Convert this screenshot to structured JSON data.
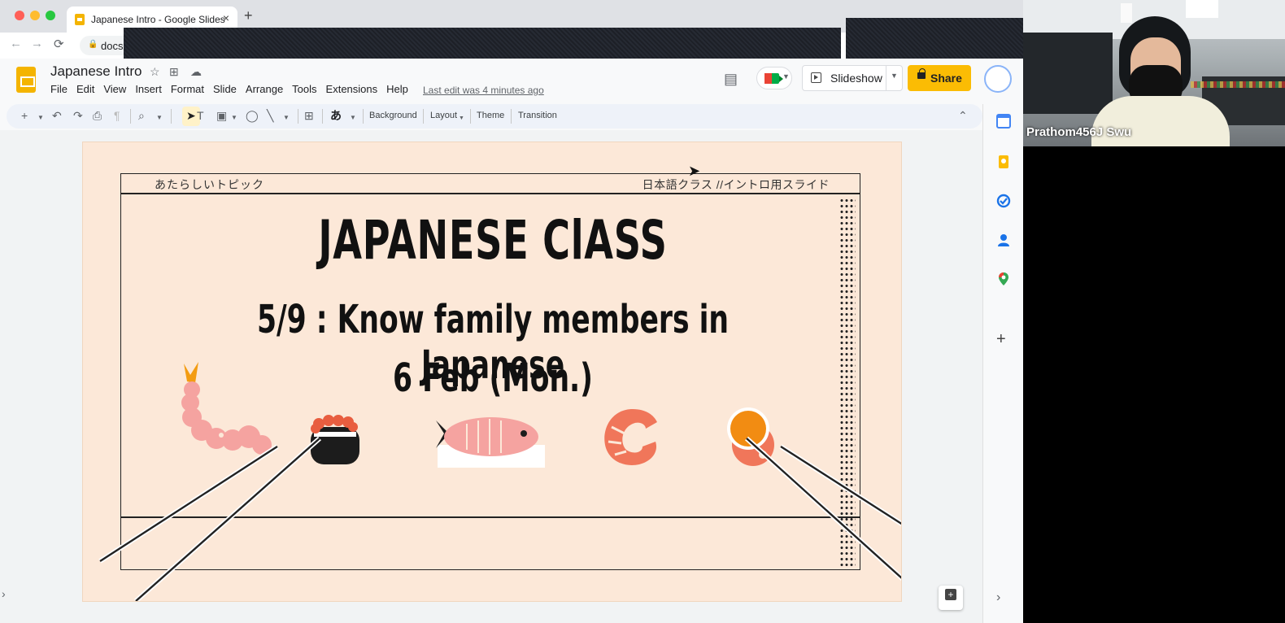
{
  "browser": {
    "tab_title": "Japanese Intro - Google Slides",
    "url_visible": "docs",
    "traffic_colors": [
      "#ff5f57",
      "#febc2e",
      "#28c840"
    ]
  },
  "slides_header": {
    "doc_title": "Japanese Intro",
    "menu": [
      "File",
      "Edit",
      "View",
      "Insert",
      "Format",
      "Slide",
      "Arrange",
      "Tools",
      "Extensions",
      "Help"
    ],
    "last_edit": "Last edit was 4 minutes ago",
    "slideshow_label": "Slideshow",
    "share_label": "Share"
  },
  "toolbar": {
    "background_label": "Background",
    "layout_label": "Layout",
    "theme_label": "Theme",
    "transition_label": "Transition",
    "input_tool_glyph": "あ"
  },
  "slide": {
    "kicker": "あたらしいトピック",
    "label": "日本語クラス //イントロ用スライド",
    "title": "JAPANESE ClASS",
    "subtitle": "5/9 : Know family members in Japanese",
    "date": "6 Feb (Mon.)",
    "background_color": "#fce8d8",
    "food_icons": [
      "shrimp-tempura-icon",
      "ikura-gunkan-icon",
      "fish-icon",
      "shrimp-icon",
      "salmon-roe-roll-icon"
    ]
  },
  "side_panel": {
    "icons": [
      "calendar-icon",
      "keep-icon",
      "tasks-icon",
      "contacts-icon",
      "maps-icon",
      "add-icon"
    ]
  },
  "video": {
    "participant_name": "Prathom456J Swu"
  }
}
